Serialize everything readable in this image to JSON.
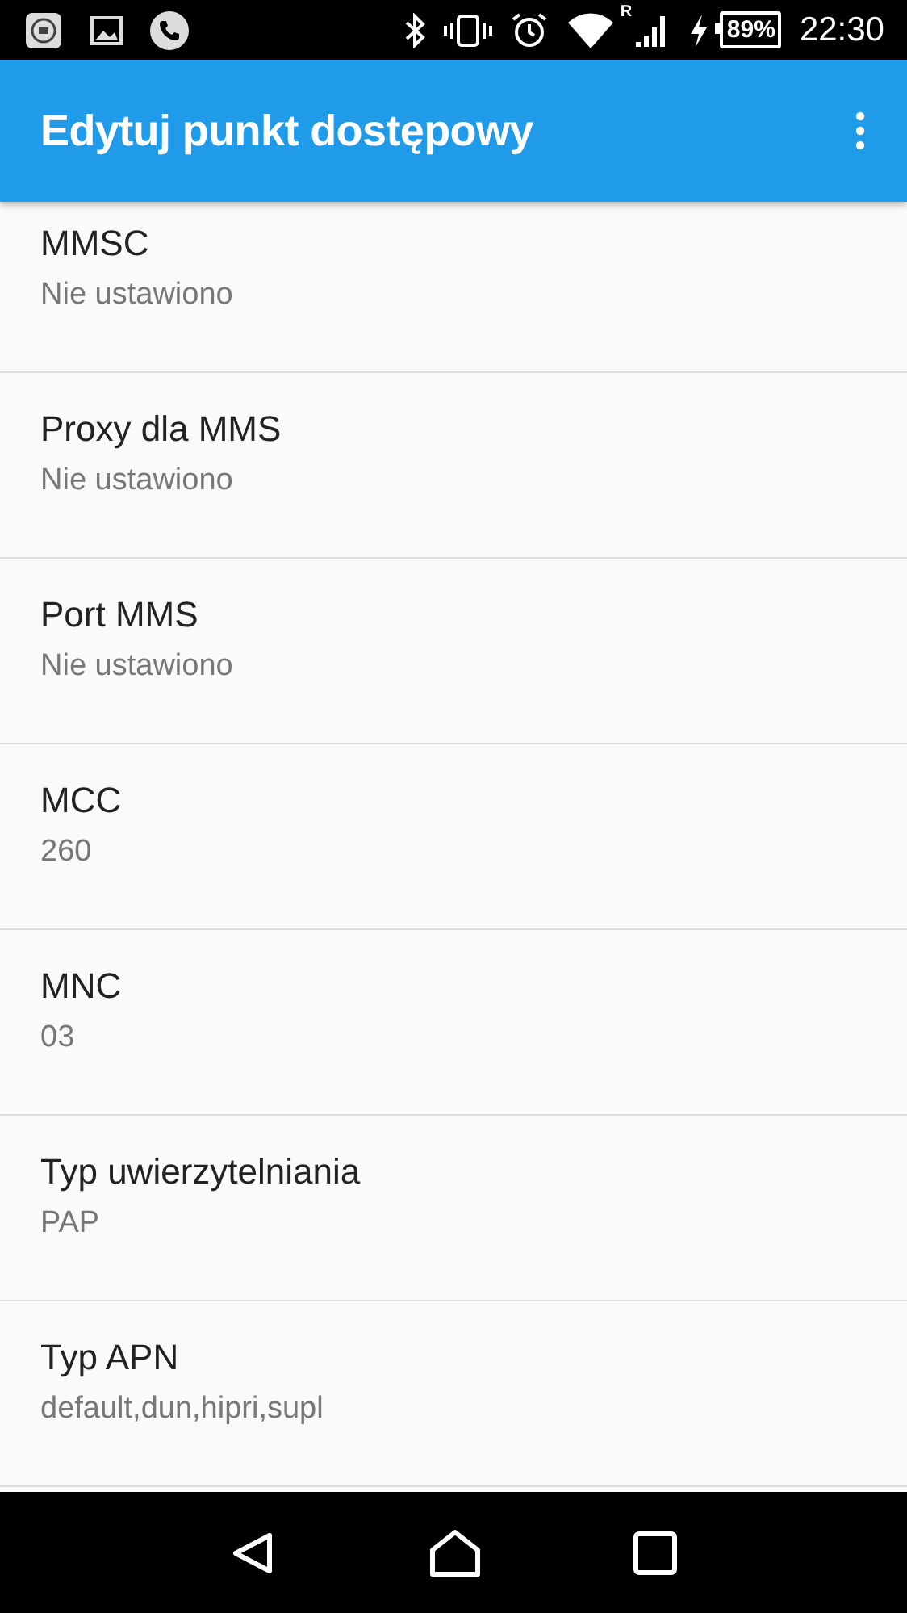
{
  "status_bar": {
    "battery": "89%",
    "time": "22:30",
    "roaming": "R"
  },
  "app_bar": {
    "title": "Edytuj punkt dostępowy"
  },
  "settings": [
    {
      "title": "MMSC",
      "value": "Nie ustawiono"
    },
    {
      "title": "Proxy dla MMS",
      "value": "Nie ustawiono"
    },
    {
      "title": "Port MMS",
      "value": "Nie ustawiono"
    },
    {
      "title": "MCC",
      "value": "260"
    },
    {
      "title": "MNC",
      "value": "03"
    },
    {
      "title": "Typ uwierzytelniania",
      "value": "PAP"
    },
    {
      "title": "Typ APN",
      "value": "default,dun,hipri,supl"
    }
  ]
}
